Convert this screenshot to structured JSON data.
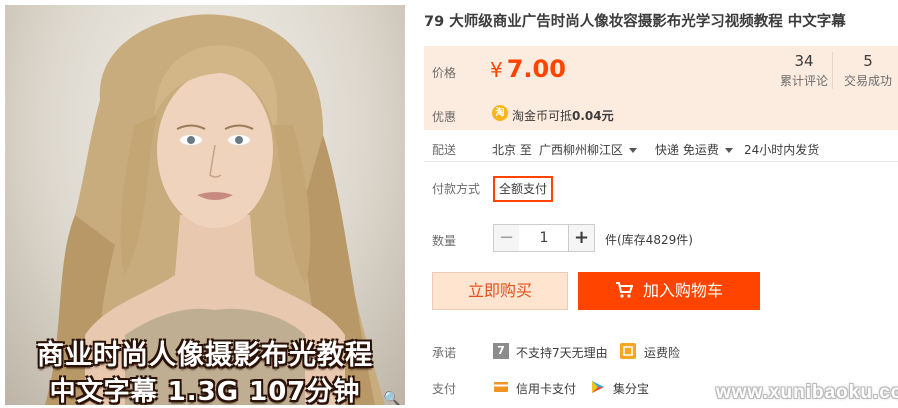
{
  "product": {
    "title": "79 大师级商业广告时尚人像妆容摄影布光学习视频教程 中文字幕",
    "image_caption_line1": "商业时尚人像摄影布光教程",
    "image_caption_line2": "中文字幕 1.3G  107分钟"
  },
  "price": {
    "label": "价格",
    "currency": "¥",
    "amount": "7.00",
    "reviews_count": "34",
    "reviews_label": "累计评论",
    "sales_count": "5",
    "sales_label": "交易成功"
  },
  "promo": {
    "label": "优惠",
    "coin_glyph": "淘",
    "text_prefix": "淘金币可抵",
    "text_amount": "0.04元"
  },
  "shipping": {
    "label": "配送",
    "from": "北京 至",
    "to": "广西柳州柳江区",
    "method": "快递 免运费",
    "dispatch": "24小时内发货"
  },
  "payment_method": {
    "label": "付款方式",
    "option": "全额支付"
  },
  "quantity": {
    "label": "数量",
    "minus": "−",
    "value": "1",
    "plus": "+",
    "stock": "件(库存4829件)"
  },
  "actions": {
    "buy_now": "立即购买",
    "add_to_cart": "加入购物车"
  },
  "promise": {
    "label": "承诺",
    "item1_glyph": "7",
    "item1": "不支持7天无理由",
    "item2": "运费险"
  },
  "pay": {
    "label": "支付",
    "item1": "信用卡支付",
    "item2": "集分宝"
  },
  "watermark": "www.xunibaoku.com",
  "colors": {
    "accent": "#ff4400",
    "price_bg": "#fcebdf",
    "buy_now_bg": "#ffe4d0"
  },
  "icons": [
    "zoom-icon",
    "taobao-coin-icon",
    "caret-down-icon",
    "cart-icon",
    "seven-days-icon",
    "shipping-insurance-icon",
    "credit-card-icon",
    "jifenbao-icon"
  ]
}
